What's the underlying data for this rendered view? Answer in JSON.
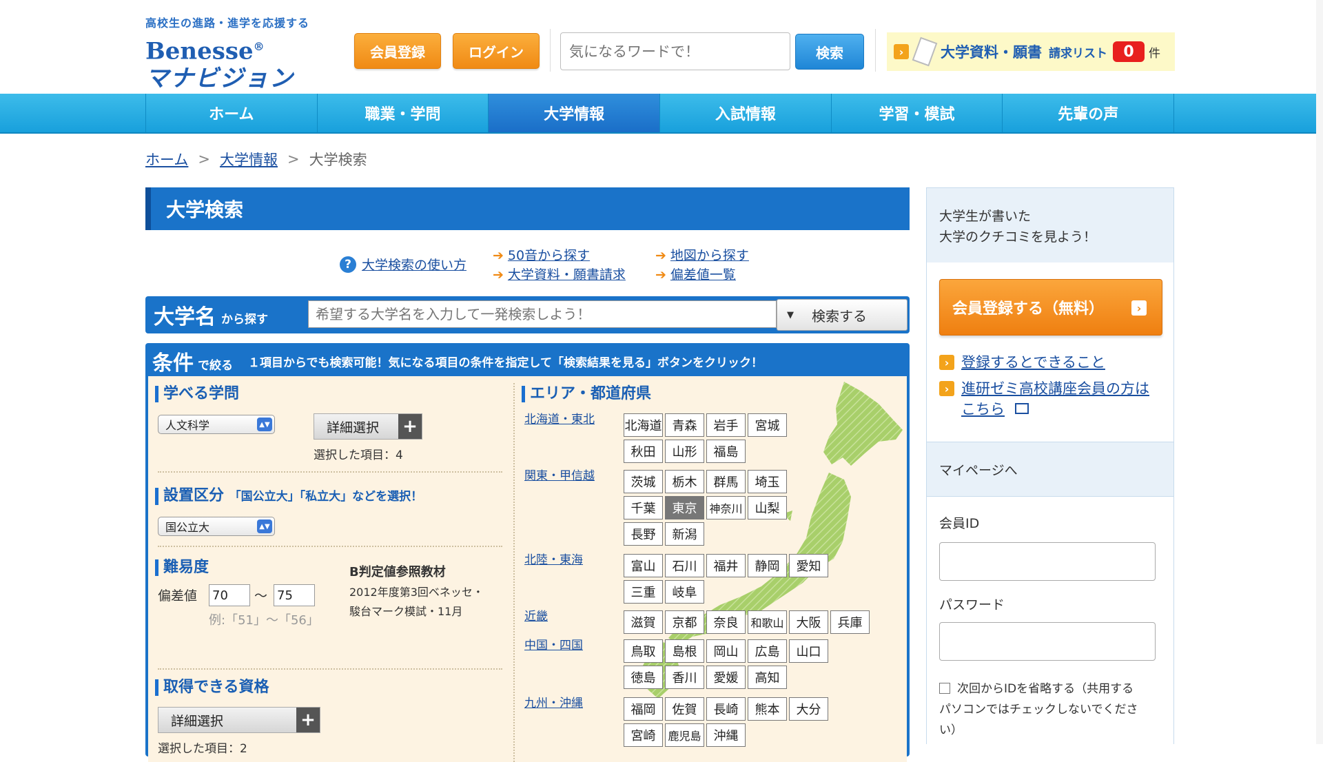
{
  "header": {
    "tagline": "高校生の進路・進学を応援する",
    "brand": "Benesse",
    "brand_mark": "®",
    "brand_sub": "マナビジョン",
    "register_label": "会員登録",
    "login_label": "ログイン",
    "search_placeholder": "気になるワードで！",
    "search_button": "検索",
    "request_label": "大学資料・願書",
    "request_list": "請求リスト",
    "request_count": "0",
    "request_unit": "件"
  },
  "nav": {
    "items": [
      "ホーム",
      "職業・学問",
      "大学情報",
      "入試情報",
      "学習・模試",
      "先輩の声"
    ],
    "active": "大学情報"
  },
  "breadcrumb": {
    "home": "ホーム",
    "univ_info": "大学情報",
    "current": "大学検索",
    "sep": ">"
  },
  "main": {
    "title": "大学検索",
    "links": {
      "howto": "大学検索の使い方",
      "kana": "50音から探す",
      "request": "大学資料・願書請求",
      "map": "地図から探す",
      "deviation": "偏差値一覧"
    },
    "name_search": {
      "title": "大学名",
      "sub": "から探す",
      "placeholder": "希望する大学名を入力して一発検索しよう！",
      "button": "検索する"
    },
    "conditions": {
      "title": "条件",
      "sub": "で絞る",
      "desc": "１項目からでも検索可能！気になる項目の条件を指定して「検索結果を見る」ボタンをクリック！",
      "subjects": {
        "title": "学べる学問",
        "select_value": "人文科学",
        "detail_button": "詳細選択",
        "selected_count": "選択した項目：4"
      },
      "category": {
        "title": "設置区分",
        "hint": "「国公立大」「私立大」などを選択！",
        "select_value": "国公立大"
      },
      "difficulty": {
        "title": "難易度",
        "label": "偏差値",
        "from": "70",
        "to": "75",
        "tilde": "〜",
        "example": "例:「51」〜「56」",
        "ref_title": "B判定値参照教材",
        "ref_text": "2012年度第3回ベネッセ・駿台マーク模試・11月"
      },
      "qualification": {
        "title": "取得できる資格",
        "detail_button": "詳細選択",
        "selected_count": "選択した項目：2"
      },
      "area": {
        "title": "エリア・都道府県",
        "regions": [
          {
            "name": "北海道・東北",
            "prefs": [
              "北海道",
              "青森",
              "岩手",
              "宮城",
              "秋田",
              "山形",
              "福島"
            ]
          },
          {
            "name": "関東・甲信越",
            "prefs": [
              "茨城",
              "栃木",
              "群馬",
              "埼玉",
              "千葉",
              "東京",
              "神奈川",
              "山梨",
              "長野",
              "新潟"
            ]
          },
          {
            "name": "北陸・東海",
            "prefs": [
              "富山",
              "石川",
              "福井",
              "静岡",
              "愛知",
              "三重",
              "岐阜"
            ]
          },
          {
            "name": "近畿",
            "prefs": [
              "滋賀",
              "京都",
              "奈良",
              "和歌山",
              "大阪",
              "兵庫"
            ]
          },
          {
            "name": "中国・四国",
            "prefs": [
              "鳥取",
              "島根",
              "岡山",
              "広島",
              "山口",
              "徳島",
              "香川",
              "愛媛",
              "高知"
            ]
          },
          {
            "name": "九州・沖縄",
            "prefs": [
              "福岡",
              "佐賀",
              "長崎",
              "熊本",
              "大分",
              "宮崎",
              "鹿児島",
              "沖縄"
            ]
          }
        ],
        "selected": "東京"
      }
    }
  },
  "sidebar": {
    "promo_line1": "大学生が書いた",
    "promo_line2": "大学のクチコミを見よう！",
    "register_button": "会員登録する（無料）",
    "link1": "登録するとできること",
    "link2_line1": "進研ゼミ高校講座会員の方は",
    "link2_line2": "こちら",
    "mypage": "マイページへ",
    "id_label": "会員ID",
    "password_label": "パスワード",
    "remember_line1": "次回からIDを省略する（共用する",
    "remember_line2": "パソコンではチェックしないでくださ",
    "remember_line3": "い）"
  },
  "colors": {
    "brand_blue": "#1a73c9",
    "nav_blue": "#18a0dc",
    "orange": "#f08a14",
    "count_red": "#e8201e",
    "map_green": "#a8cf6a"
  }
}
